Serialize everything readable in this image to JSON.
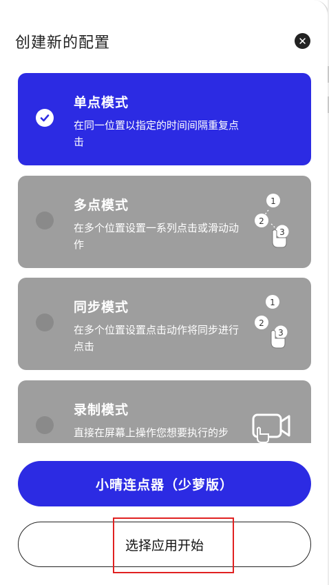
{
  "dialog": {
    "title": "创建新的配置",
    "close_icon": "close-icon"
  },
  "modes": [
    {
      "title": "单点模式",
      "description": "在同一位置以指定的时间间隔重复点击",
      "selected": true,
      "icon": "check-icon"
    },
    {
      "title": "多点模式",
      "description": "在多个位置设置一系列点击或滑动动作",
      "selected": false,
      "icon": "multi-tap-illustration",
      "markers": [
        "1",
        "2",
        "3"
      ]
    },
    {
      "title": "同步模式",
      "description": "在多个位置设置点击动作将同步进行点击",
      "selected": false,
      "icon": "sync-tap-illustration",
      "markers": [
        "1",
        "2",
        "3"
      ]
    },
    {
      "title": "录制模式",
      "description": "直接在屏幕上操作您想要执行的步骤，同轨操作将自动添加",
      "selected": false,
      "icon": "video-record-icon"
    }
  ],
  "actions": {
    "primary_label": "小晴连点器（少萝版）",
    "secondary_label": "选择应用开始"
  },
  "colors": {
    "accent": "#2c2be3",
    "card_inactive": "#9e9e9e",
    "highlight": "#e02020"
  }
}
